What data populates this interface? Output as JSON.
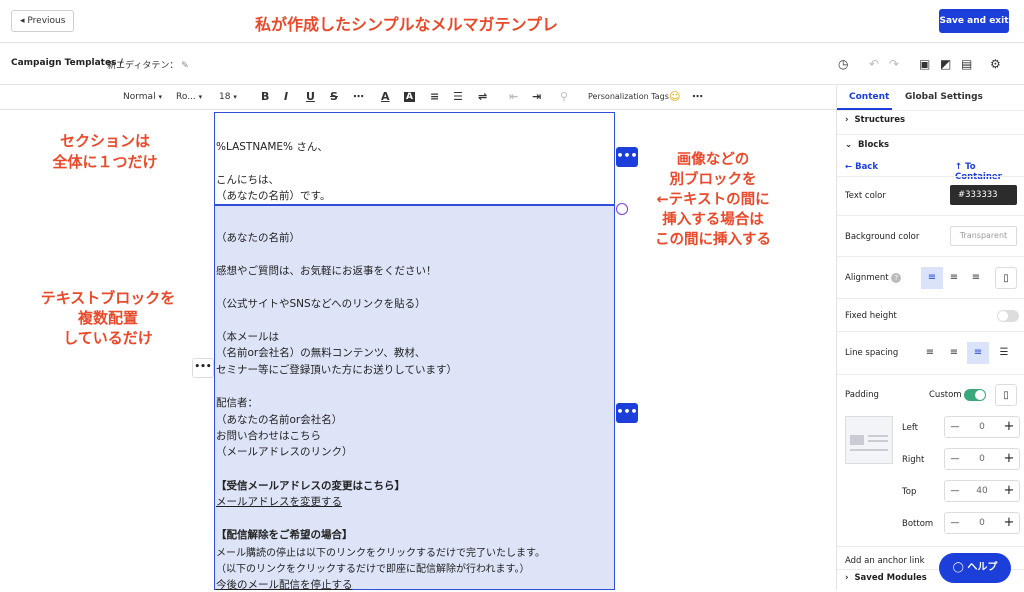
{
  "topbar": {
    "previous_label": "Previous",
    "save_exit_label": "Save and exit",
    "annotation_title": "私が作成したシンプルなメルマガテンプレ"
  },
  "breadcrumb": {
    "root": "Campaign Templates",
    "separator": "/",
    "current": "新エディタテン："
  },
  "toolbar": {
    "font_style": "Normal",
    "font_family": "Ro...",
    "font_size": "18",
    "personalization": "Personalization Tags"
  },
  "email": {
    "block1": [
      "%LASTNAME% さん、",
      "こんにちは、",
      "（あなたの名前）です。"
    ],
    "block2": [
      "（あなたの名前）",
      "感想やご質問は、お気軽にお返事をください！",
      "（公式サイトやSNSなどへのリンクを貼る）",
      "（本メールは",
      "（名前or会社名）の無料コンテンツ、教材、",
      "セミナー等にご登録頂いた方にお送りしています）",
      "配信者：",
      "（あなたの名前or会社名）",
      "お問い合わせはこちら",
      "（メールアドレスのリンク）",
      "【受信メールアドレスの変更はこちら】",
      "メールアドレスを変更する",
      "【配信解除をご希望の場合】",
      "メール購読の停止は以下のリンクをクリックするだけで完了いたします。",
      "（以下のリンクをクリックするだけで即座に配信解除が行われます。）",
      "今後のメール配信を停止する"
    ]
  },
  "annotations": {
    "section": [
      "セクションは",
      "全体に１つだけ"
    ],
    "text_blocks": [
      "テキストブロックを",
      "複数配置",
      "しているだけ"
    ],
    "insert": [
      "画像などの",
      "別ブロックを",
      "←テキストの間に",
      "挿入する場合は",
      "この間に挿入する"
    ]
  },
  "panel": {
    "tab_content": "Content",
    "tab_global": "Global Settings",
    "structures": "Structures",
    "blocks": "Blocks",
    "back": "Back",
    "to_container": "To Container",
    "text_color_label": "Text color",
    "text_color_value": "#333333",
    "bg_color_label": "Background color",
    "bg_color_value": "Transparent",
    "alignment_label": "Alignment",
    "fixed_height_label": "Fixed height",
    "line_spacing_label": "Line spacing",
    "padding_label": "Padding",
    "padding_mode": "Custom",
    "left_label": "Left",
    "left_value": "0",
    "right_label": "Right",
    "right_value": "0",
    "top_label": "Top",
    "top_value": "40",
    "bottom_label": "Bottom",
    "bottom_value": "0",
    "anchor_label": "Add an anchor link",
    "saved_modules": "Saved Modules"
  },
  "chat": {
    "label": "ヘルプ"
  },
  "colors": {
    "accent": "#1b3fd8",
    "annotation": "#e84a2a",
    "selected_block": "#dde4f7"
  }
}
